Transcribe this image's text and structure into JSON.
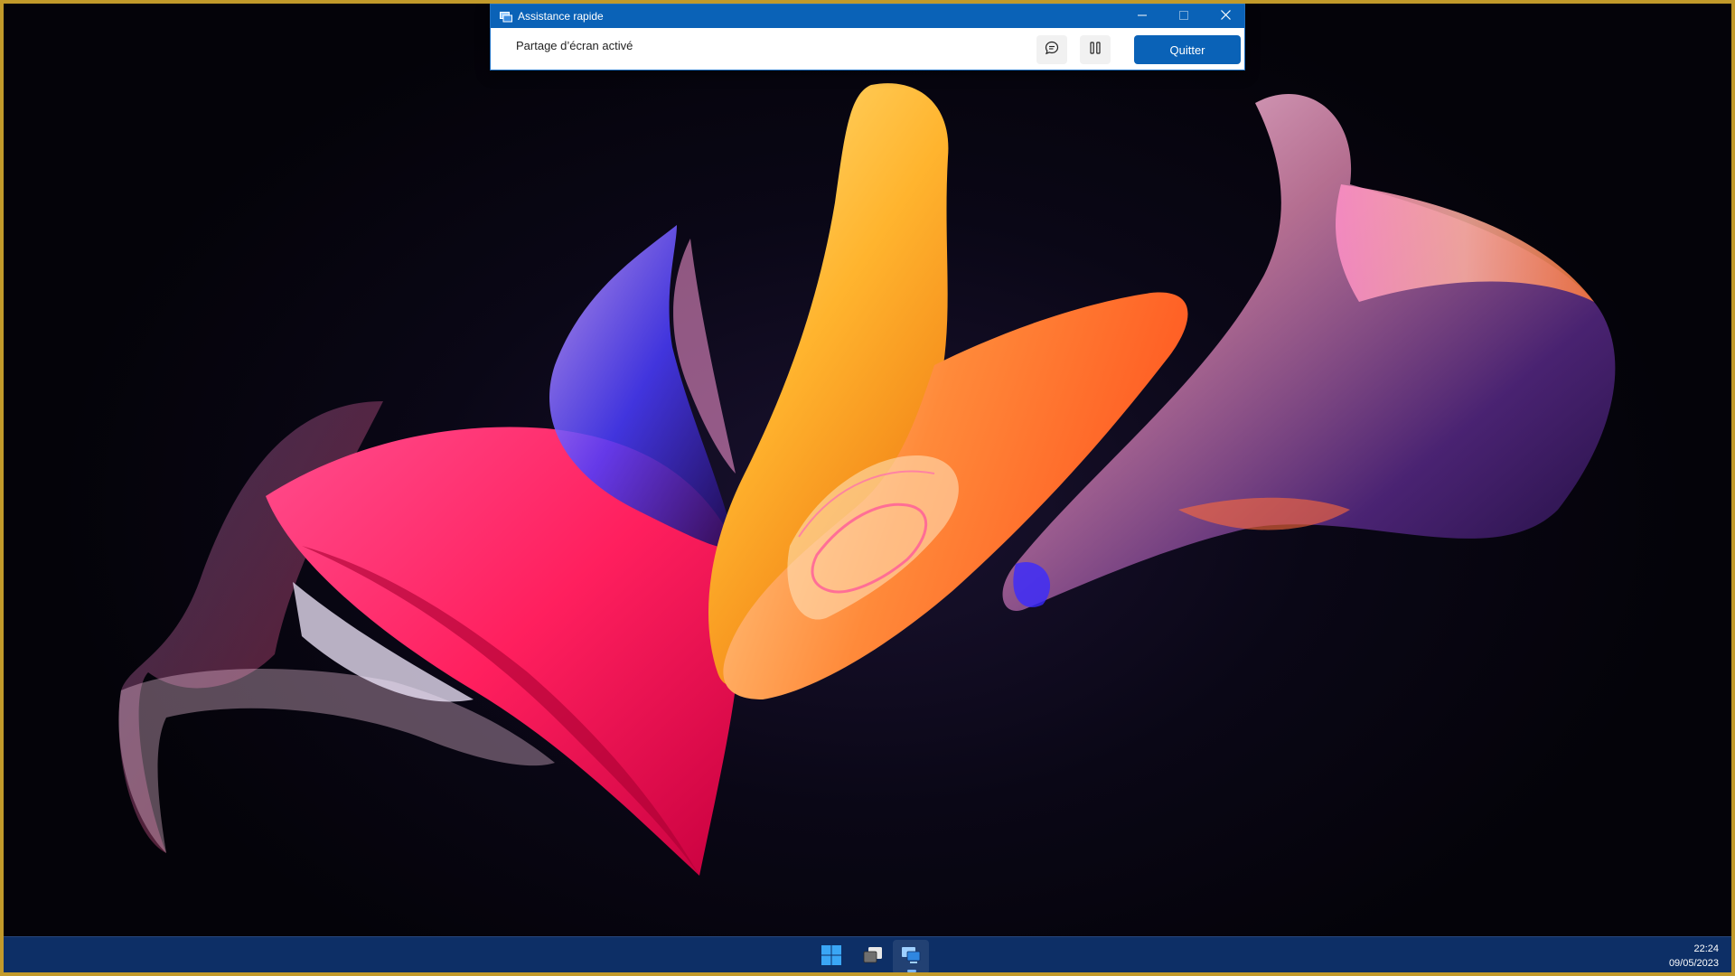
{
  "window": {
    "title": "Assistance rapide",
    "status_text": "Partage d’écran activé",
    "quit_label": "Quitter",
    "chat_icon": "chat-bubble-icon",
    "pause_icon": "pause-icon",
    "minimize_icon": "minimize-icon",
    "maximize_icon": "maximize-icon",
    "close_icon": "close-icon"
  },
  "taskbar": {
    "items": [
      {
        "name": "start",
        "icon": "windows-logo-icon"
      },
      {
        "name": "task-view",
        "icon": "task-view-icon"
      },
      {
        "name": "quick-assist",
        "icon": "quick-assist-icon",
        "active": true
      }
    ],
    "time": "22:24",
    "date": "09/05/2023"
  },
  "colors": {
    "frame_border": "#c29a2a",
    "title_bar": "#0a62b7",
    "accent_button": "#0a62b7",
    "taskbar": "#0d2f66",
    "desktop_background": "#05030c"
  }
}
